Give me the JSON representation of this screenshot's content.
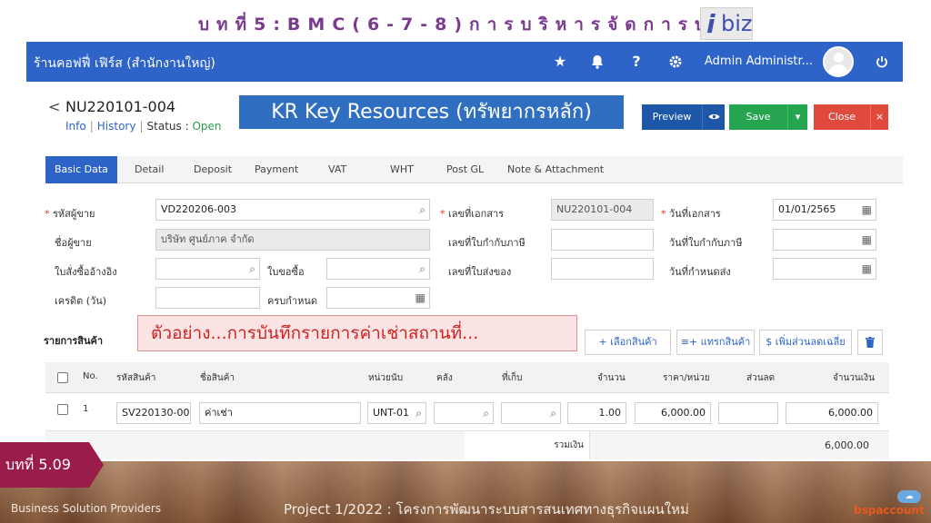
{
  "slide_title": "บทที่5:BMC(6-7-8)การบริหารจัดการบน",
  "ibiz_logo": {
    "i": "i",
    "rest": "biz"
  },
  "app": {
    "shop_name": "ร้านคอฟฟี่ เฟิร์ส (สำนักงานใหญ่)",
    "topbar_icons": [
      "star-icon",
      "bell-icon",
      "help-icon",
      "gear-icon"
    ],
    "user_name": "Admin Administr...",
    "power_icon": "power-icon",
    "doc_no": "NU220101-004",
    "back_glyph": "<",
    "links": {
      "info": "Info",
      "history": "History",
      "status_label": "Status",
      "status_sep": ":",
      "status_value": "Open",
      "sep": "|"
    },
    "buttons": {
      "preview": "Preview",
      "save": "Save",
      "close": "Close"
    },
    "tabs": [
      "Basic Data",
      "Detail",
      "Deposit",
      "Payment",
      "VAT",
      "WHT",
      "Post GL",
      "Note & Attachment"
    ],
    "form": {
      "supplier_code_label": "รหัสผู้ขาย",
      "supplier_code_value": "VD220206-003",
      "supplier_name_label": "ชื่อผู้ขาย",
      "supplier_name_value": "บริษัท ศูนย์ภาค จำกัด",
      "po_ref_label": "ใบสั่งซื้ออ้างอิง",
      "pr_label": "ใบขอซื้อ",
      "credit_label": "เครดิต (วัน)",
      "due_label": "ครบกำหนด",
      "doc_no_label": "เลขที่เอกสาร",
      "doc_no_value": "NU220101-004",
      "tax_inv_no_label": "เลขที่ใบกำกับภาษี",
      "delivery_no_label": "เลขที่ใบส่งของ",
      "doc_date_label": "วันที่เอกสาร",
      "doc_date_value": "01/01/2565",
      "tax_inv_date_label": "วันที่ใบกำกับภาษี",
      "delivery_date_label": "วันที่กำหนดส่ง"
    },
    "items_section": "รายการสินค้า",
    "line_buttons": {
      "select": "+ เลือกสินค้า",
      "insert": "แทรกสินค้า",
      "discount": "$ เพิ่มส่วนลดเฉลี่ย"
    },
    "table": {
      "headers": [
        "No.",
        "รหัสสินค้า",
        "ชื่อสินค้า",
        "หน่วยนับ",
        "คลัง",
        "ที่เก็บ",
        "จำนวน",
        "ราคา/หน่วย",
        "ส่วนลด",
        "จำนวนเงิน"
      ],
      "rows": [
        {
          "no": "1",
          "code": "SV220130-00",
          "name": "ค่าเช่า",
          "unit": "UNT-01",
          "qty": "1.00",
          "price": "6,000.00",
          "amount": "6,000.00"
        }
      ],
      "total_label": "รวมเงิน",
      "total_value": "6,000.00"
    }
  },
  "kr_banner": "KR Key Resources (ทรัพยากรหลัก)",
  "example_banner": "ตัวอย่าง...การบันทึกรายการค่าเช่าสถานที่...",
  "chapter_badge": "บทที่ 5.09",
  "footer": {
    "left": "Business Solution Providers",
    "project": "Project 1/2022 : โครงการพัฒนาระบบสารสนเทศทางธุรกิจแผนใหม่",
    "logo_text": "bspaccount"
  },
  "colors": {
    "primary": "#2e64c8",
    "save": "#25a550",
    "close": "#e04a3c",
    "title": "#7a3b8f",
    "badge": "#9a1c4a"
  }
}
